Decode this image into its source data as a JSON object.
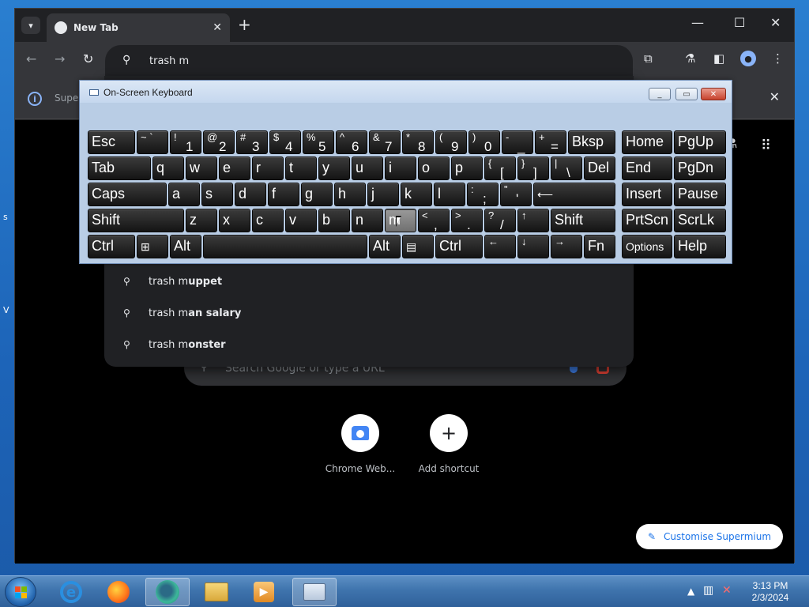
{
  "browser": {
    "tab": {
      "title": "New Tab",
      "close": "✕"
    },
    "new_tab_label": "+",
    "omnibox": {
      "value": "trash m"
    },
    "infobar": {
      "text": "Supe"
    },
    "new_tab_page": {
      "search_placeholder": "Search Google or type a URL",
      "shortcuts": [
        {
          "label": "Chrome Web..."
        },
        {
          "label": "Add shortcut"
        }
      ],
      "customise_label": "Customise Supermium"
    },
    "suggestions": [
      {
        "prefix": "trash m",
        "completion": "uppet"
      },
      {
        "prefix": "trash m",
        "completion": "an salary"
      },
      {
        "prefix": "trash m",
        "completion": "onster"
      }
    ]
  },
  "osk": {
    "title": "On-Screen Keyboard",
    "keys": {
      "esc": "Esc",
      "bksp": "Bksp",
      "home": "Home",
      "pgup": "PgUp",
      "tab": "Tab",
      "del": "Del",
      "end": "End",
      "pgdn": "PgDn",
      "caps": "Caps",
      "insert": "Insert",
      "pause": "Pause",
      "shift_l": "Shift",
      "shift_r": "Shift",
      "prtscn": "PrtScn",
      "scrlk": "ScrLk",
      "ctrl_l": "Ctrl",
      "alt_l": "Alt",
      "alt_r": "Alt",
      "ctrl_r": "Ctrl",
      "fn": "Fn",
      "options": "Options",
      "help": "Help",
      "q": "q",
      "w": "w",
      "e": "e",
      "r": "r",
      "t": "t",
      "y": "y",
      "u": "u",
      "i": "i",
      "o": "o",
      "p": "p",
      "a": "a",
      "s": "s",
      "d": "d",
      "f": "f",
      "g": "g",
      "h": "h",
      "j": "j",
      "k": "k",
      "l": "l",
      "z": "z",
      "x": "x",
      "c": "c",
      "v": "v",
      "b": "b",
      "n": "n",
      "m": "m"
    }
  },
  "taskbar": {
    "clock": {
      "time": "3:13 PM",
      "date": "2/3/2024"
    }
  }
}
